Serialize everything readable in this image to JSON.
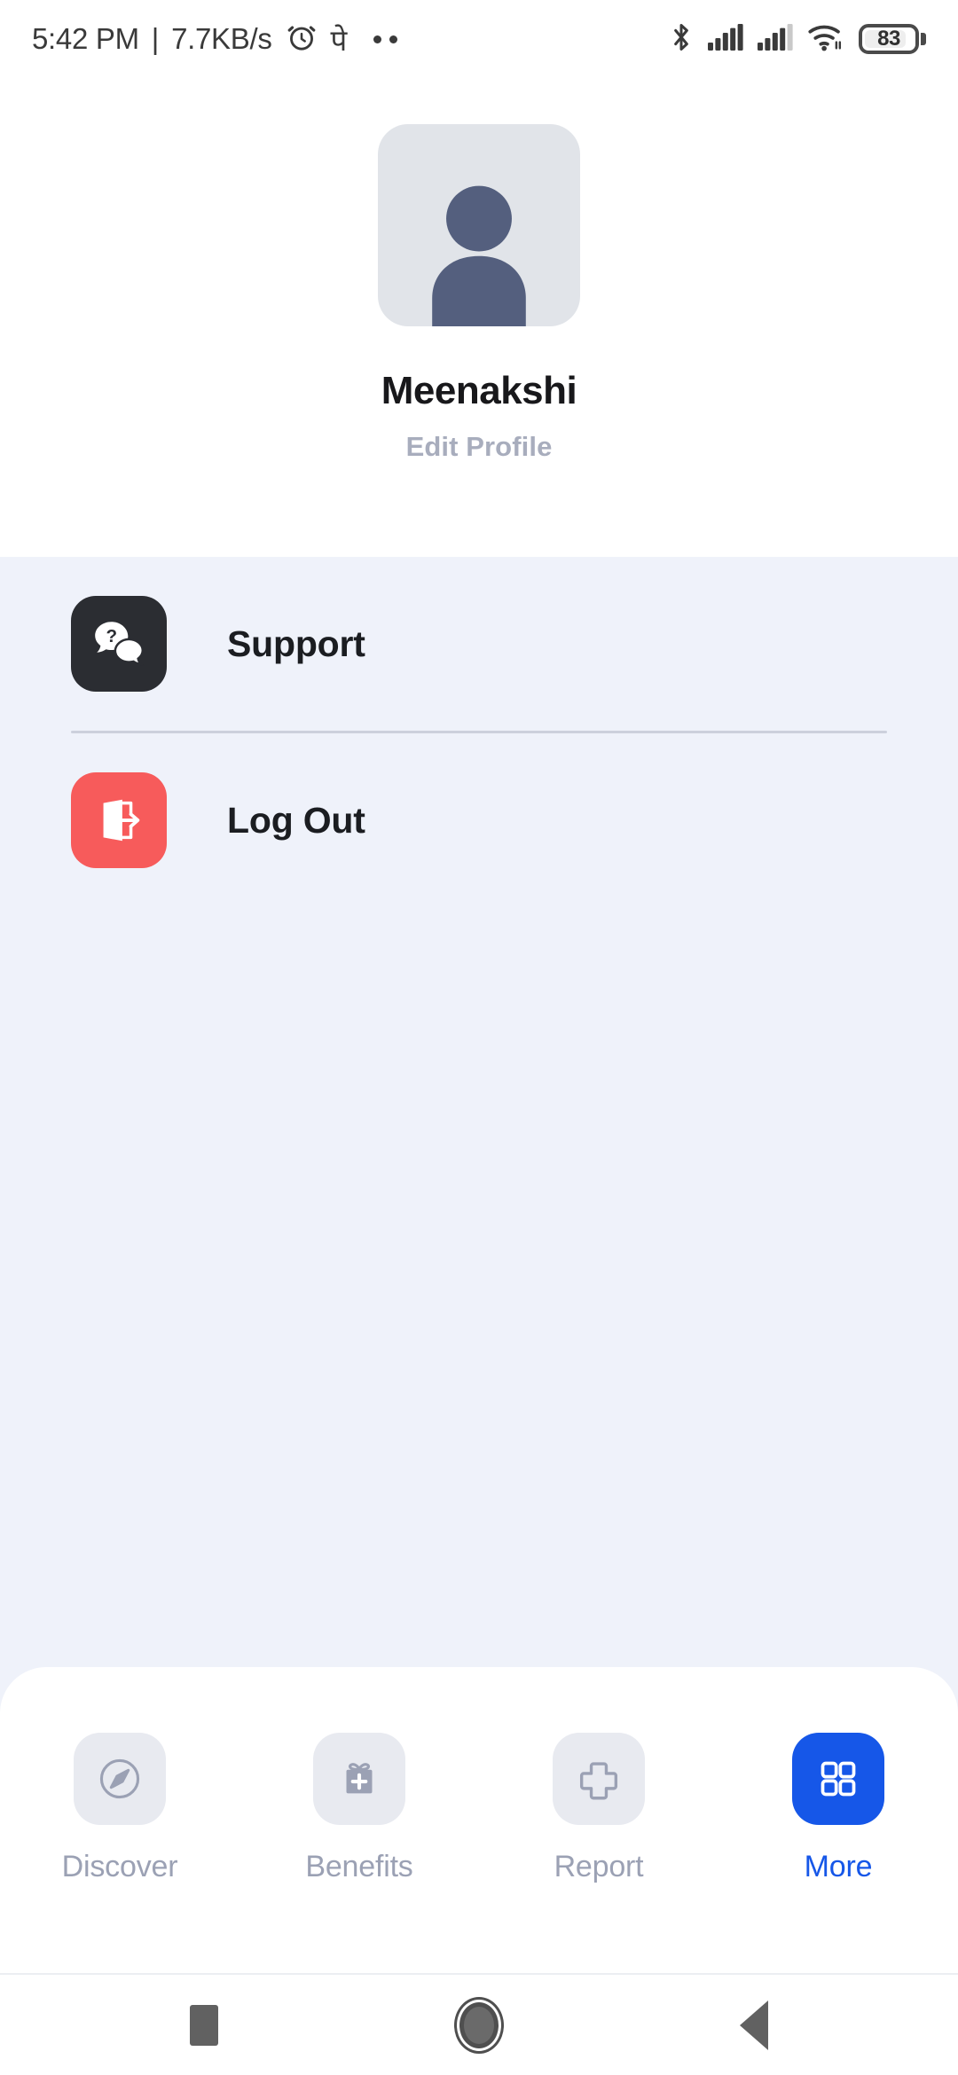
{
  "status_bar": {
    "time": "5:42 PM",
    "separator": "|",
    "network_speed": "7.7KB/s",
    "alarm_icon": "alarm-clock-icon",
    "app_glyph": "पे",
    "overflow_icon": "more-dots-icon",
    "bluetooth_icon": "bluetooth-icon",
    "signal_one_icon": "cellular-signal-icon",
    "signal_two_icon": "cellular-signal-icon",
    "wifi_icon": "wifi-icon",
    "battery_level": "83"
  },
  "profile": {
    "avatar_icon": "person-avatar-icon",
    "name": "Meenakshi",
    "edit_link": "Edit Profile"
  },
  "menu": {
    "items": [
      {
        "label": "Support",
        "icon": "chat-question-icon",
        "icon_bg": "#2b2d32"
      },
      {
        "label": "Log Out",
        "icon": "logout-door-icon",
        "icon_bg": "#f75b5b"
      }
    ]
  },
  "bottom_nav": {
    "active_color": "#1657e8",
    "inactive_color": "#9ba1b4",
    "items": [
      {
        "label": "Discover",
        "icon": "compass-icon",
        "active": false
      },
      {
        "label": "Benefits",
        "icon": "gift-plus-icon",
        "active": false
      },
      {
        "label": "Report",
        "icon": "medical-cross-icon",
        "active": false
      },
      {
        "label": "More",
        "icon": "grid-four-squares-icon",
        "active": true
      }
    ]
  },
  "system_nav": {
    "recents_label": "recents-button",
    "home_label": "home-button",
    "back_label": "back-button"
  }
}
